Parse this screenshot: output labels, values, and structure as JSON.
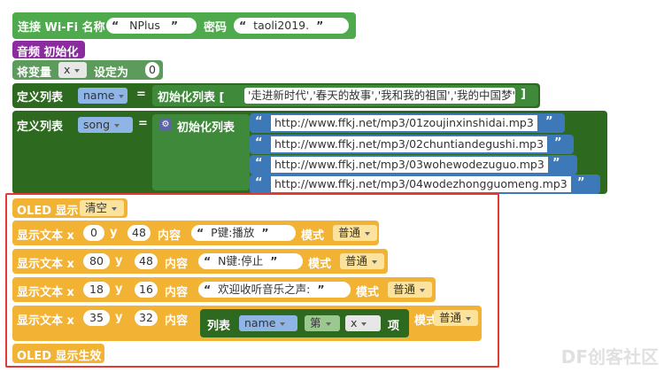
{
  "colors": {
    "wifi": "#4eaa4d",
    "audio": "#8a2b9e",
    "var": "#5c9b5c",
    "listdef": "#2d6a1f",
    "listitem": "#3d78b8",
    "oled": "#f2b233",
    "sublist": "#2d6a1f"
  },
  "wifi": {
    "label": "连接 Wi-Fi 名称",
    "ssid": "NPlus",
    "pwd_label": "密码",
    "pwd": "taoli2019."
  },
  "audio": {
    "label": "音频 初始化"
  },
  "setvar": {
    "label": "将变量",
    "var": "x",
    "setto": "设定为",
    "value": "0"
  },
  "list1": {
    "label": "定义列表",
    "name": "name",
    "eq": "=",
    "init": "初始化列表 [",
    "items": "'走进新时代','春天的故事','我和我的祖国','我的中国梦'",
    "close": "]"
  },
  "list2": {
    "label": "定义列表",
    "name": "song",
    "eq": "=",
    "init": "初始化列表",
    "urls": [
      "http://www.ffkj.net/mp3/01zoujinxinshidai.mp3",
      "http://www.ffkj.net/mp3/02chuntiandegushi.mp3",
      "http://www.ffkj.net/mp3/03wohewodezuguo.mp3",
      "http://www.ffkj.net/mp3/04wodezhongguomeng.mp3"
    ]
  },
  "oled": {
    "show_label": "OLED 显示",
    "clear": "清空",
    "text_label": "显示文本 x",
    "y_label": "y",
    "content_label": "内容",
    "mode_label": "模式",
    "mode": "普通",
    "rows": [
      {
        "x": "0",
        "y": "48",
        "text": "P键:播放"
      },
      {
        "x": "80",
        "y": "48",
        "text": "N键:停止"
      },
      {
        "x": "18",
        "y": "16",
        "text": "欢迎收听音乐之声:"
      }
    ],
    "row4": {
      "x": "35",
      "y": "32",
      "list_label": "列表",
      "list_name": "name",
      "nth": "第",
      "idx": "x",
      "item": "项"
    },
    "effect": "OLED 显示生效"
  },
  "quote_open": "“",
  "quote_close": "”",
  "watermark": "DF创客社区"
}
